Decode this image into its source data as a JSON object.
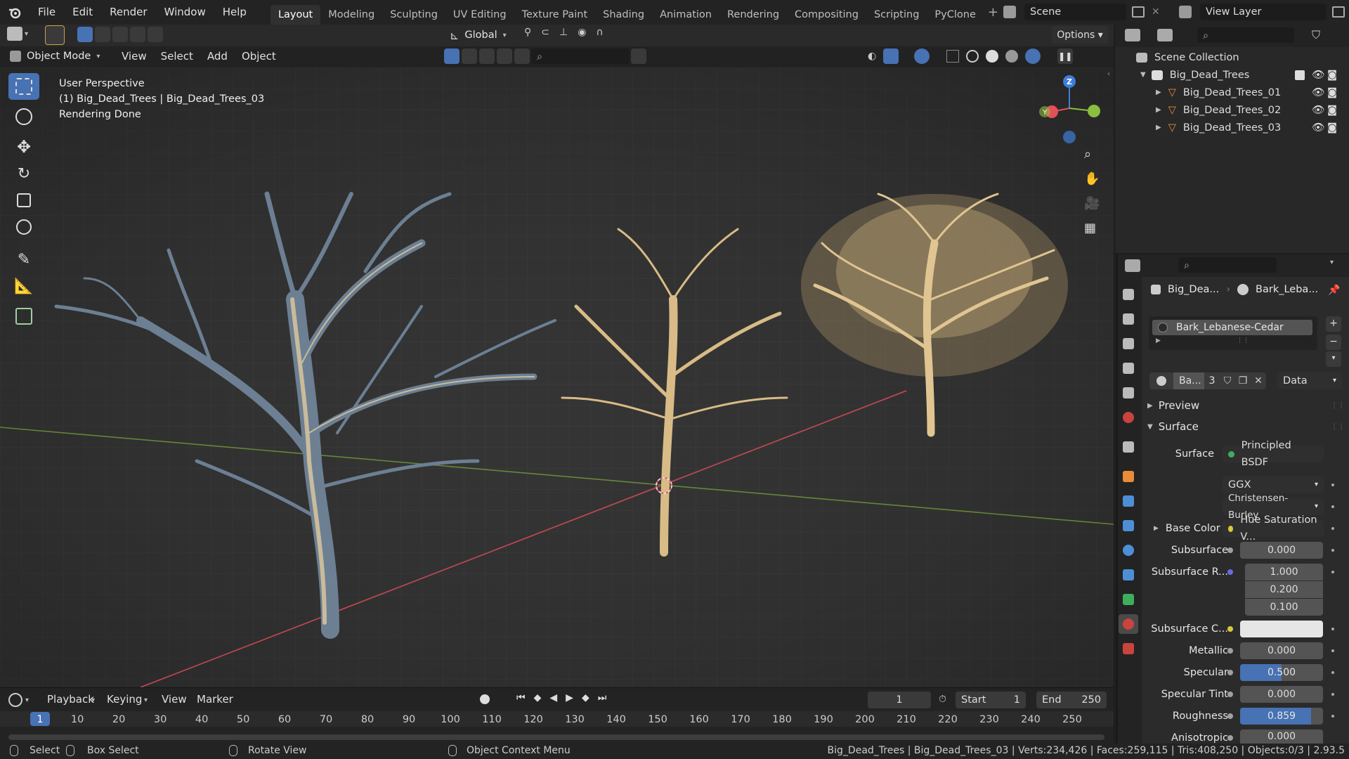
{
  "menu": [
    "File",
    "Edit",
    "Render",
    "Window",
    "Help"
  ],
  "workspaces": [
    "Layout",
    "Modeling",
    "Sculpting",
    "UV Editing",
    "Texture Paint",
    "Shading",
    "Animation",
    "Rendering",
    "Compositing",
    "Scripting",
    "PyClone"
  ],
  "scene": "Scene",
  "view_layer": "View Layer",
  "toolbar": {
    "orientation": "Global",
    "options": "Options"
  },
  "viewport_header": {
    "mode": "Object Mode",
    "menus": [
      "View",
      "Select",
      "Add",
      "Object"
    ]
  },
  "overlay_text": {
    "line1": "User Perspective",
    "line2": "(1) Big_Dead_Trees | Big_Dead_Trees_03",
    "line3": "Rendering Done"
  },
  "outliner": {
    "root": "Scene Collection",
    "collection": "Big_Dead_Trees",
    "items": [
      "Big_Dead_Trees_01",
      "Big_Dead_Trees_02",
      "Big_Dead_Trees_03"
    ]
  },
  "properties": {
    "breadcrumb_object": "Big_Dea...",
    "breadcrumb_material": "Bark_Leba...",
    "slot_name": "Bark_Lebanese-Cedar",
    "material_short": "Ba...",
    "user_count": "3",
    "data_dropdown": "Data",
    "preview": "Preview",
    "surface_panel": "Surface",
    "surface_label": "Surface",
    "surface_value": "Principled BSDF",
    "distribution": "GGX",
    "subsurface_method": "Christensen-Burley",
    "base_color_label": "Base Color",
    "base_color_value": "Hue Saturation V...",
    "subsurface_label": "Subsurface",
    "subsurface_value": "0.000",
    "subsurface_radius_label": "Subsurface R...",
    "radius": [
      "1.000",
      "0.200",
      "0.100"
    ],
    "subsurface_color_label": "Subsurface C...",
    "metallic_label": "Metallic",
    "metallic_value": "0.000",
    "specular_label": "Specular",
    "specular_value": "0.500",
    "specular_fill": 0.5,
    "specular_tint_label": "Specular Tint",
    "specular_tint_value": "0.000",
    "roughness_label": "Roughness",
    "roughness_value": "0.859",
    "roughness_fill": 0.859,
    "anisotropic_label": "Anisotropic",
    "anisotropic_value": "0.000"
  },
  "timeline": {
    "menus": [
      "Playback",
      "Keying",
      "View",
      "Marker"
    ],
    "current": "1",
    "start_label": "Start",
    "start": "1",
    "end_label": "End",
    "end": "250",
    "ticks": [
      "1",
      "10",
      "20",
      "30",
      "40",
      "50",
      "60",
      "70",
      "80",
      "90",
      "100",
      "110",
      "120",
      "130",
      "140",
      "150",
      "160",
      "170",
      "180",
      "190",
      "200",
      "210",
      "220",
      "230",
      "240",
      "250"
    ]
  },
  "status": {
    "select": "Select",
    "box_select": "Box Select",
    "rotate": "Rotate View",
    "context": "Object Context Menu",
    "stats": "Big_Dead_Trees | Big_Dead_Trees_03 | Verts:234,426 | Faces:259,115 | Tris:408,250 | Objects:0/3 | 2.93.5"
  },
  "colors": {
    "accent": "#4772b3",
    "x_axis": "#e34f5a",
    "y_axis": "#8bbd3e",
    "z_axis": "#3d7ed9",
    "bark_light": "#e8cf9e",
    "bark_blue": "#6c7f93"
  }
}
